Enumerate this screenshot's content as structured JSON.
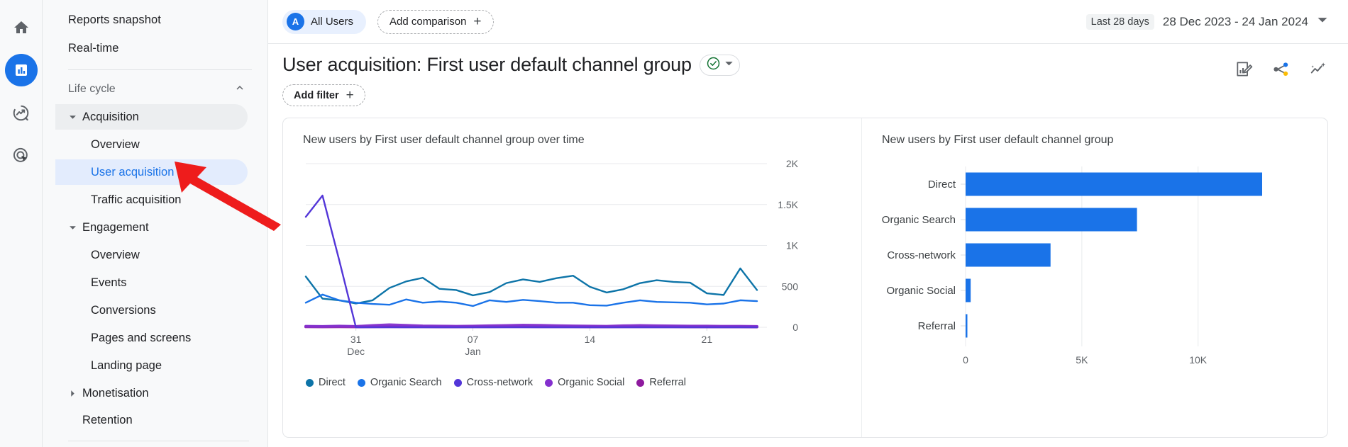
{
  "app": {
    "rail": [
      {
        "name": "home",
        "icon": "home-icon",
        "active": false
      },
      {
        "name": "reports",
        "icon": "bar-chart-icon",
        "active": true
      },
      {
        "name": "explore",
        "icon": "explore-icon",
        "active": false
      },
      {
        "name": "advertising",
        "icon": "advertising-target-icon",
        "active": false
      }
    ]
  },
  "sidebar": {
    "top_items": [
      {
        "label": "Reports snapshot"
      },
      {
        "label": "Real-time"
      }
    ],
    "section": {
      "label": "Life cycle",
      "expanded": true
    },
    "groups": [
      {
        "label": "Acquisition",
        "expanded": true,
        "shaded": true,
        "children": [
          {
            "label": "Overview",
            "selected": false
          },
          {
            "label": "User acquisition",
            "selected": true
          },
          {
            "label": "Traffic acquisition",
            "selected": false
          }
        ]
      },
      {
        "label": "Engagement",
        "expanded": true,
        "shaded": false,
        "children": [
          {
            "label": "Overview",
            "selected": false
          },
          {
            "label": "Events",
            "selected": false
          },
          {
            "label": "Conversions",
            "selected": false
          },
          {
            "label": "Pages and screens",
            "selected": false
          },
          {
            "label": "Landing page",
            "selected": false
          }
        ]
      },
      {
        "label": "Monetisation",
        "expanded": false,
        "shaded": false,
        "children": []
      }
    ],
    "trailing_items": [
      {
        "label": "Retention"
      }
    ]
  },
  "topbar": {
    "all_users_label": "All Users",
    "all_users_avatar": "A",
    "add_comparison_label": "Add comparison",
    "date_pill": "Last 28 days",
    "date_range": "28 Dec 2023 - 24 Jan 2024"
  },
  "header": {
    "title": "User acquisition: First user default channel group",
    "add_filter_label": "Add filter",
    "actions": [
      {
        "name": "customise-report-icon",
        "label": "Customise report"
      },
      {
        "name": "share-icon",
        "label": "Share this report"
      },
      {
        "name": "insights-icon",
        "label": "Insights"
      }
    ]
  },
  "colors": {
    "accent": "#1a73e8",
    "direct": "#0d74a8",
    "organic_search": "#1a73e8",
    "cross_network": "#5336d8",
    "organic_social": "#8430ce",
    "referral": "#8e1a9e",
    "bar_fill": "#1a73e8",
    "grid": "#e8eaed",
    "annotation_arrow": "#ee1c1c"
  },
  "chart_data": [
    {
      "type": "line",
      "title": "New users by First user default channel group over time",
      "xlabel": "",
      "ylabel": "",
      "ylim": [
        0,
        2000
      ],
      "ytick_labels": [
        "0",
        "500",
        "1K",
        "1.5K",
        "2K"
      ],
      "ytick_values": [
        0,
        500,
        1000,
        1500,
        2000
      ],
      "xtick_labels": [
        "31\nDec",
        "07\nJan",
        "14",
        "21"
      ],
      "xtick_indices": [
        3,
        10,
        17,
        24
      ],
      "grid": true,
      "legend_position": "bottom",
      "x": [
        "28 Dec",
        "29 Dec",
        "30 Dec",
        "31 Dec",
        "01 Jan",
        "02 Jan",
        "03 Jan",
        "04 Jan",
        "05 Jan",
        "06 Jan",
        "07 Jan",
        "08 Jan",
        "09 Jan",
        "10 Jan",
        "11 Jan",
        "12 Jan",
        "13 Jan",
        "14 Jan",
        "15 Jan",
        "16 Jan",
        "17 Jan",
        "18 Jan",
        "19 Jan",
        "20 Jan",
        "21 Jan",
        "22 Jan",
        "23 Jan",
        "24 Jan"
      ],
      "series": [
        {
          "name": "Direct",
          "color": "#0d74a8",
          "values": [
            620,
            350,
            330,
            290,
            330,
            480,
            560,
            605,
            470,
            455,
            390,
            430,
            540,
            585,
            555,
            600,
            630,
            495,
            425,
            465,
            540,
            575,
            555,
            545,
            415,
            395,
            720,
            455
          ]
        },
        {
          "name": "Organic Search",
          "color": "#1a73e8",
          "values": [
            300,
            400,
            330,
            300,
            285,
            275,
            340,
            300,
            315,
            300,
            260,
            330,
            310,
            335,
            320,
            300,
            300,
            270,
            265,
            300,
            330,
            310,
            305,
            300,
            280,
            290,
            330,
            320
          ]
        },
        {
          "name": "Cross-network",
          "color": "#5336d8",
          "values": [
            1350,
            1610,
            820,
            0,
            0,
            0,
            0,
            0,
            0,
            0,
            0,
            0,
            0,
            0,
            0,
            0,
            0,
            0,
            0,
            0,
            0,
            0,
            0,
            0,
            0,
            0,
            0,
            0
          ]
        },
        {
          "name": "Organic Social",
          "color": "#8430ce",
          "values": [
            12,
            10,
            14,
            10,
            22,
            30,
            24,
            16,
            14,
            12,
            14,
            18,
            22,
            26,
            24,
            20,
            16,
            14,
            12,
            18,
            22,
            18,
            16,
            14,
            14,
            12,
            12,
            10
          ]
        },
        {
          "name": "Referral",
          "color": "#8e1a9e",
          "values": [
            6,
            5,
            7,
            5,
            6,
            8,
            7,
            6,
            5,
            5,
            6,
            7,
            8,
            8,
            7,
            6,
            6,
            5,
            5,
            6,
            7,
            6,
            6,
            5,
            5,
            5,
            5,
            4
          ]
        }
      ]
    },
    {
      "type": "bar",
      "orientation": "horizontal",
      "title": "New users by First user default channel group",
      "xlabel": "",
      "ylabel": "",
      "categories": [
        "Direct",
        "Organic Search",
        "Cross-network",
        "Organic Social",
        "Referral"
      ],
      "values": [
        12756,
        7372,
        3654,
        218,
        64
      ],
      "xlim": [
        0,
        12756
      ],
      "xtick_labels": [
        "0",
        "5K",
        "10K"
      ],
      "xtick_values": [
        0,
        5000,
        10000
      ],
      "grid": true,
      "bar_color": "#1a73e8"
    }
  ],
  "annotation": {
    "type": "arrow",
    "color": "#ee1c1c",
    "points_to": "User acquisition"
  }
}
